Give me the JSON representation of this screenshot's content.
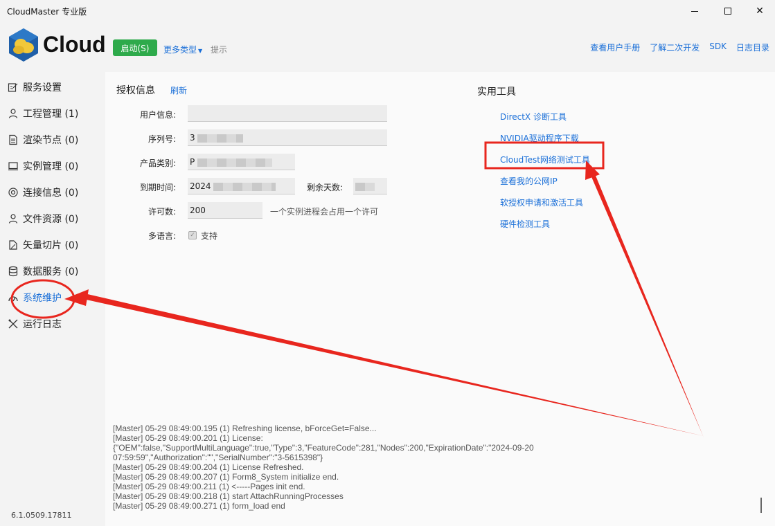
{
  "window": {
    "title": "CloudMaster 专业版"
  },
  "header": {
    "logo_text": "Cloud",
    "start_button": "启动(S)",
    "more_types": "更多类型",
    "tip": "提示",
    "links": [
      "查看用户手册",
      "了解二次开发",
      "SDK",
      "日志目录"
    ]
  },
  "sidebar": {
    "items": [
      {
        "label": "服务设置",
        "icon": "settings-edit-icon"
      },
      {
        "label": "工程管理 (1)",
        "icon": "person-icon"
      },
      {
        "label": "渲染节点 (0)",
        "icon": "document-icon"
      },
      {
        "label": "实例管理 (0)",
        "icon": "monitor-icon"
      },
      {
        "label": "连接信息 (0)",
        "icon": "connection-icon"
      },
      {
        "label": "文件资源 (0)",
        "icon": "person-icon"
      },
      {
        "label": "矢量切片 (0)",
        "icon": "tile-icon"
      },
      {
        "label": "数据服务 (0)",
        "icon": "database-icon"
      },
      {
        "label": "系统维护",
        "icon": "maintenance-icon"
      },
      {
        "label": "运行日志",
        "icon": "tools-icon"
      }
    ],
    "version": "6.1.0509.17811"
  },
  "license": {
    "title": "授权信息",
    "refresh": "刷新",
    "fields": {
      "user_info_label": "用户信息:",
      "user_info_value": "",
      "serial_label": "序列号:",
      "serial_value": "3",
      "product_label": "产品类别:",
      "product_value": "P",
      "expiry_label": "到期时间:",
      "expiry_value": "2024",
      "remaining_label": "剩余天数:",
      "remaining_value": "",
      "permits_label": "许可数:",
      "permits_value": "200",
      "permits_hint": "一个实例进程会占用一个许可",
      "multilang_label": "多语言:",
      "multilang_check": "支持"
    }
  },
  "tools": {
    "title": "实用工具",
    "links": [
      "DirectX 诊断工具",
      "NVIDIA驱动程序下载",
      "CloudTest网络测试工具",
      "查看我的公网IP",
      "软授权申请和激活工具",
      "硬件检测工具"
    ]
  },
  "log": {
    "lines": [
      "[Master] 05-29 08:49:00.195 (1) Refreshing license, bForceGet=False...",
      "[Master] 05-29 08:49:00.201 (1) License:",
      "{\"OEM\":false,\"SupportMultiLanguage\":true,\"Type\":3,\"FeatureCode\":281,\"Nodes\":200,\"ExpirationDate\":\"2024-09-20",
      "07:59:59\",\"Authorization\":\"\",\"SerialNumber\":\"3-5615398\"}",
      "[Master] 05-29 08:49:00.204 (1) License Refreshed.",
      "[Master] 05-29 08:49:00.207 (1) Form8_System initialize end.",
      "[Master] 05-29 08:49:00.211 (1) <-----Pages init end.",
      "[Master] 05-29 08:49:00.218 (1) start AttachRunningProcesses",
      "[Master] 05-29 08:49:00.271 (1) form_load end"
    ]
  },
  "colors": {
    "accent": "#1a6fd8",
    "start_green": "#2eaa4b",
    "annotation_red": "#e8261e"
  }
}
